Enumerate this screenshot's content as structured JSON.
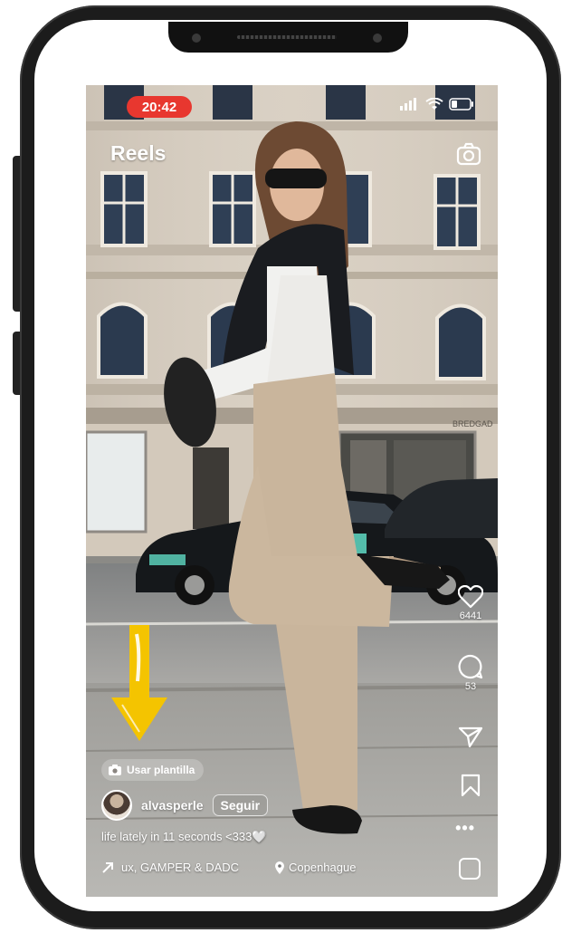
{
  "status": {
    "time": "20:42"
  },
  "header": {
    "title": "Reels"
  },
  "actions": {
    "likes": "6441",
    "comments": "53"
  },
  "template": {
    "label": "Usar plantilla"
  },
  "post": {
    "username": "alvasperle",
    "follow_label": "Seguir",
    "caption": "life lately in 11 seconds <333🤍",
    "music": "ux, GAMPER & DADC",
    "location": "Copenhague"
  },
  "scene": {
    "street_sign": "BREDGAD"
  },
  "colors": {
    "time_pill": "#e8372f",
    "arrow": "#f4c400"
  },
  "icons": [
    "camera-icon",
    "heart-icon",
    "comment-icon",
    "send-icon",
    "bookmark-icon",
    "more-icon",
    "audio-thumb-icon"
  ]
}
